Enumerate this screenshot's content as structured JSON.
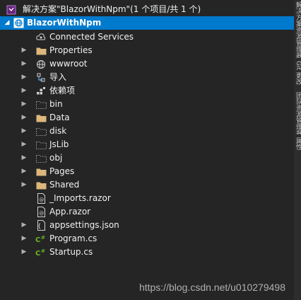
{
  "solution": {
    "label": "解决方案\"BlazorWithNpm\"(1 个项目/共 1 个)"
  },
  "project": {
    "label": "BlazorWithNpm"
  },
  "items": [
    {
      "label": "Connected Services",
      "icon": "connected-services-icon"
    },
    {
      "label": "Properties",
      "icon": "folder-icon"
    },
    {
      "label": "wwwroot",
      "icon": "globe-icon"
    },
    {
      "label": "导入",
      "icon": "import-icon"
    },
    {
      "label": "依赖项",
      "icon": "dependencies-icon"
    },
    {
      "label": "bin",
      "icon": "hidden-folder-icon"
    },
    {
      "label": "Data",
      "icon": "folder-icon"
    },
    {
      "label": "disk",
      "icon": "hidden-folder-icon"
    },
    {
      "label": "JsLib",
      "icon": "hidden-folder-icon"
    },
    {
      "label": "obj",
      "icon": "hidden-folder-icon"
    },
    {
      "label": "Pages",
      "icon": "folder-icon"
    },
    {
      "label": "Shared",
      "icon": "folder-icon"
    },
    {
      "label": "_Imports.razor",
      "icon": "razor-file-icon"
    },
    {
      "label": "App.razor",
      "icon": "razor-file-icon"
    },
    {
      "label": "appsettings.json",
      "icon": "json-file-icon"
    },
    {
      "label": "Program.cs",
      "icon": "csharp-file-icon"
    },
    {
      "label": "Startup.cs",
      "icon": "csharp-file-icon"
    }
  ],
  "side_tabs": [
    "解决方案资源管理器",
    "Git 更改",
    "团队资源管理器",
    "属性"
  ],
  "watermark": "https://blog.csdn.net/u010279498",
  "colors": {
    "selection": "#007acc",
    "folder": "#dcb67a",
    "csharp": "#68b723",
    "background": "#252526"
  }
}
